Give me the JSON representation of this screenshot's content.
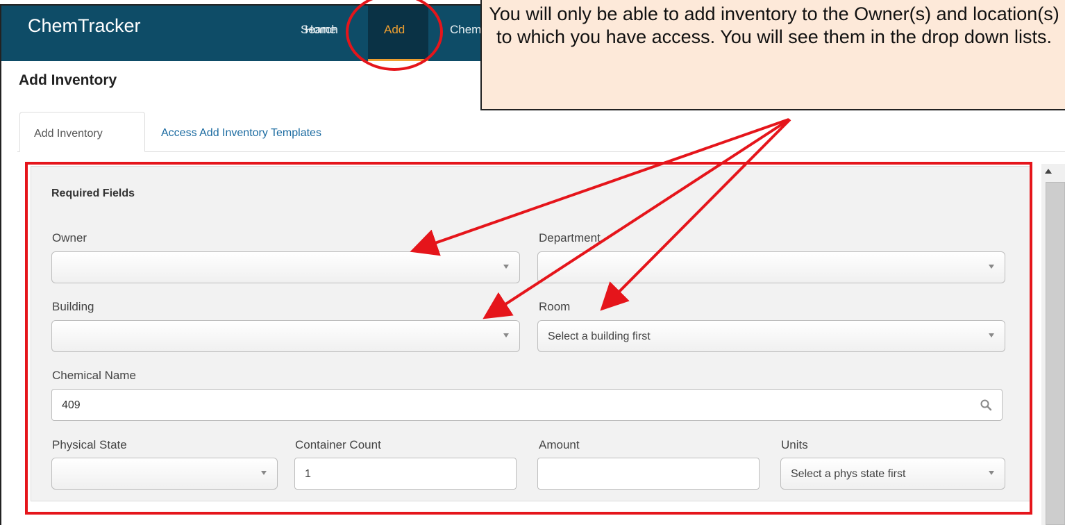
{
  "app": {
    "brand": "ChemTracker",
    "nav": {
      "home": "Home",
      "search": "Search",
      "add": "Add",
      "chem": "Chem"
    }
  },
  "page": {
    "title": "Add Inventory",
    "tabs": [
      "Add Inventory",
      "Access Add Inventory Templates"
    ]
  },
  "form": {
    "section_title": "Required Fields",
    "owner": {
      "label": "Owner",
      "value": ""
    },
    "department": {
      "label": "Department",
      "value": ""
    },
    "building": {
      "label": "Building",
      "value": ""
    },
    "room": {
      "label": "Room",
      "value": "Select a building first"
    },
    "chemical_name": {
      "label": "Chemical Name",
      "value": "409"
    },
    "physical_state": {
      "label": "Physical State",
      "value": ""
    },
    "container_count": {
      "label": "Container Count",
      "value": "1"
    },
    "amount": {
      "label": "Amount",
      "value": ""
    },
    "units": {
      "label": "Units",
      "value": "Select a phys state first"
    }
  },
  "annotation": {
    "callout_text": "You will only be able to add inventory to the Owner(s) and location(s) to which you have access. You will see them in the drop down lists.",
    "highlight_color": "#e5151b",
    "callout_bg": "#fde9d9"
  },
  "colors": {
    "navbar": "#0e4c67",
    "active_accent": "#f0a030",
    "link": "#1a6aa0"
  },
  "icons": {
    "search": "magnifier-icon",
    "dropdown": "caret-down-icon"
  }
}
